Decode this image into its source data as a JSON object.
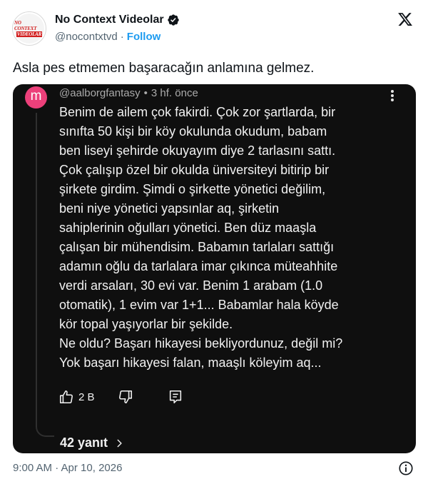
{
  "author": {
    "display_name": "No Context Videolar",
    "handle": "@nocontxtvd",
    "follow_label": "Follow",
    "avatar_text": [
      "NO CONTEXT",
      "VIDEOLAR"
    ],
    "verified": true
  },
  "tweet": {
    "text": "Asla pes etmemen başaracağın anlamına gelmez."
  },
  "embedded_comment": {
    "avatar_letter": "m",
    "username": "@aalborgfantasy",
    "age": "3 hf. önce",
    "lines": [
      "Benim de ailem çok fakirdi. Çok zor şartlarda, bir",
      "sınıfta 50 kişi bir köy okulunda okudum, babam",
      "ben liseyi şehirde okuyayım diye 2 tarlasını sattı.",
      "Çok çalışıp özel bir okulda üniversiteyi bitirip bir",
      "şirkete girdim. Şimdi o şirkette yönetici değilim,",
      "beni niye yönetici yapsınlar aq, şirketin",
      "sahiplerinin oğulları yönetici. Ben düz maaşla",
      "çalışan bir mühendisim. Babamın tarlaları sattığı",
      "adamın oğlu da tarlalara imar çıkınca müteahhite",
      "verdi arsaları, 30 evi var. Benim 1 arabam (1.0",
      "otomatik), 1 evim var 1+1... Babamlar hala köyde",
      "kör topal yaşıyorlar bir şekilde.",
      "Ne oldu? Başarı hikayesi bekliyordunuz, değil mi?",
      "Yok başarı hikayesi falan, maaşlı köleyim aq..."
    ],
    "like_count": "2 B",
    "replies_label": "42 yanıt"
  },
  "footer": {
    "timestamp": "9:00 AM · Apr 10, 2026"
  },
  "colors": {
    "accent": "#1d9bf0",
    "card_bg": "#0f0f0f",
    "comment_avatar": "#ec407a",
    "muted_text": "#536471"
  },
  "icons": [
    "verified-badge-icon",
    "x-logo-icon",
    "kebab-menu-icon",
    "thumbs-up-icon",
    "thumbs-down-icon",
    "reply-icon",
    "chevron-right-icon",
    "info-icon"
  ]
}
